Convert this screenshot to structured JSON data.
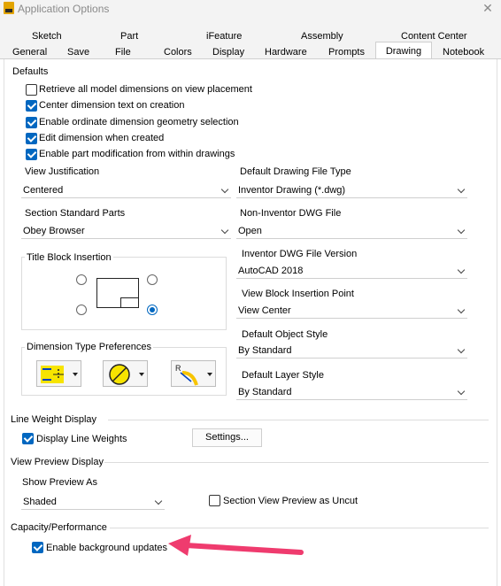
{
  "window": {
    "title": "Application Options",
    "close_glyph": "✕"
  },
  "tabs_top": [
    "Sketch",
    "Part",
    "iFeature",
    "Assembly",
    "Content Center"
  ],
  "tabs_bottom": [
    "General",
    "Save",
    "File",
    "Colors",
    "Display",
    "Hardware",
    "Prompts",
    "Drawing",
    "Notebook"
  ],
  "active_tab": "Drawing",
  "defaults": {
    "heading": "Defaults",
    "checks": [
      {
        "label": "Retrieve all model dimensions on view placement",
        "checked": false
      },
      {
        "label": "Center dimension text on creation",
        "checked": true
      },
      {
        "label": "Enable ordinate dimension geometry selection",
        "checked": true
      },
      {
        "label": "Edit dimension when created",
        "checked": true
      },
      {
        "label": "Enable part modification from within drawings",
        "checked": true
      }
    ]
  },
  "view_justification": {
    "label": "View Justification",
    "value": "Centered"
  },
  "default_drawing_file_type": {
    "label": "Default Drawing File Type",
    "value": "Inventor Drawing (*.dwg)"
  },
  "section_standard_parts": {
    "label": "Section Standard Parts",
    "value": "Obey Browser"
  },
  "non_inventor_dwg": {
    "label": "Non-Inventor DWG File",
    "value": "Open"
  },
  "title_block_insertion": {
    "label": "Title Block Insertion",
    "selected": "bottom-right"
  },
  "dwg_version": {
    "label": "Inventor DWG File Version",
    "value": "AutoCAD 2018"
  },
  "view_block_insertion": {
    "label": "View Block Insertion Point",
    "value": "View Center"
  },
  "dimension_type_prefs": {
    "label": "Dimension Type Preferences",
    "icons": [
      "linear-dimension-icon",
      "diameter-dimension-icon",
      "radius-dimension-icon"
    ]
  },
  "default_object_style": {
    "label": "Default Object Style",
    "value": "By Standard"
  },
  "default_layer_style": {
    "label": "Default Layer Style",
    "value": "By Standard"
  },
  "line_weight": {
    "heading": "Line Weight Display",
    "check_label": "Display Line Weights",
    "checked": true,
    "settings_button": "Settings..."
  },
  "view_preview": {
    "heading": "View Preview Display",
    "show_label": "Show Preview As",
    "show_value": "Shaded",
    "section_label": "Section View Preview as Uncut",
    "section_checked": false
  },
  "capacity": {
    "heading": "Capacity/Performance",
    "check_label": "Enable background updates",
    "checked": true
  },
  "colors": {
    "accent": "#0067c0",
    "annotation_arrow": "#ef3b6e"
  }
}
